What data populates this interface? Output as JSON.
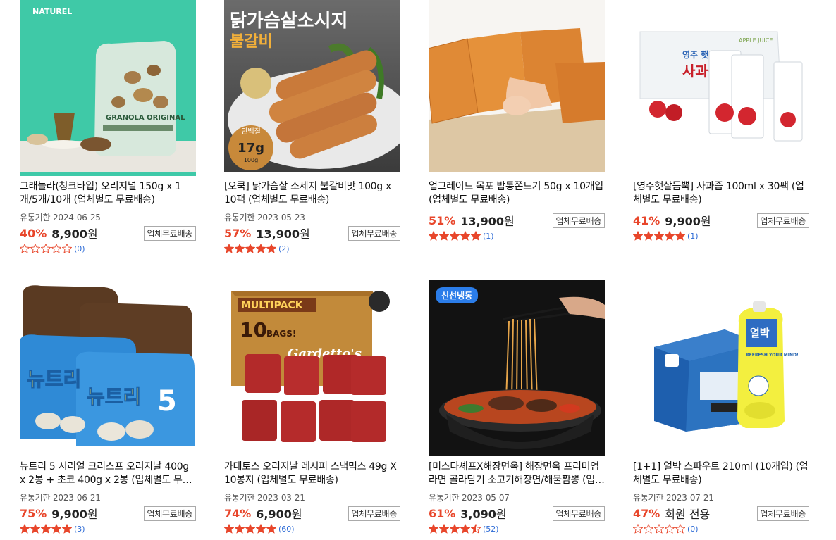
{
  "products": [
    {
      "title": "그래놀라(청크타입) 오리지널 150g x 1개/5개/10개 (업체별도 무료배송)",
      "expiry": "유통기한 2024-06-25",
      "discount": "40%",
      "price": "8,900",
      "price_unit": "원",
      "member_only": "",
      "shipping": "업체무료배송",
      "rating": 0,
      "reviews": "(0)",
      "image_brand": "NATUREL",
      "image_text": "GRANOLA ORIGINAL",
      "badge": ""
    },
    {
      "title": "[오쿡] 닭가슴살 소세지 불갈비맛 100g x 10팩 (업체별도 무료배송)",
      "expiry": "유통기한 2023-05-23",
      "discount": "57%",
      "price": "13,900",
      "price_unit": "원",
      "member_only": "",
      "shipping": "업체무료배송",
      "rating": 5,
      "reviews": "(2)",
      "image_headline": "닭가슴살소시지",
      "image_sub": "불갈비",
      "image_protein_label": "단백질",
      "image_protein_value": "17g",
      "image_protein_unit": "100g",
      "badge": ""
    },
    {
      "title": "업그레이드 목포 밥통쫀드기 50g x 10개입 (업체별도 무료배송)",
      "expiry": "",
      "discount": "51%",
      "price": "13,900",
      "price_unit": "원",
      "member_only": "",
      "shipping": "업체무료배송",
      "rating": 5,
      "reviews": "(1)",
      "badge": ""
    },
    {
      "title": "[영주햇살듬뿍] 사과즙 100ml x 30팩 (업체별도 무료배송)",
      "expiry": "",
      "discount": "41%",
      "price": "9,900",
      "price_unit": "원",
      "member_only": "",
      "shipping": "업체무료배송",
      "rating": 5,
      "reviews": "(1)",
      "image_box_text": "APPLE JUICE",
      "image_brand": "영주 햇살듬뿍",
      "image_product": "사과즙",
      "badge": ""
    },
    {
      "title": "뉴트리 5 시리얼 크리스프 오리지날 400g x 2봉 + 초코 400g x 2봉 (업체별도 무료배송)",
      "expiry": "유통기한 2023-06-21",
      "discount": "75%",
      "price": "9,900",
      "price_unit": "원",
      "member_only": "",
      "shipping": "업체무료배송",
      "rating": 5,
      "reviews": "(3)",
      "image_brand": "뉴트리",
      "image_number": "5",
      "badge": ""
    },
    {
      "title": "가데토스 오리지날 레시피 스낵믹스 49g X 10봉지 (업체별도 무료배송)",
      "expiry": "유통기한 2023-03-21",
      "discount": "74%",
      "price": "6,900",
      "price_unit": "원",
      "member_only": "",
      "shipping": "업체무료배송",
      "rating": 5,
      "reviews": "(60)",
      "image_box": "MULTIPACK",
      "image_count": "10",
      "image_bags": "BAGS!",
      "image_brand": "Gardetto's",
      "badge": ""
    },
    {
      "title": "[미스타셰프X해장면옥] 해장면옥 프리미엄 라면 골라담기 소고기해장면/해물짬뽕 (업체별도 무료배송)",
      "expiry": "유통기한 2023-05-07",
      "discount": "61%",
      "price": "3,090",
      "price_unit": "원",
      "member_only": "",
      "shipping": "업체무료배송",
      "rating": 4.5,
      "reviews": "(52)",
      "badge": "신선냉동"
    },
    {
      "title": "[1+1] 얼박 스파우트 210ml (10개입) (업체별도 무료배송)",
      "expiry": "유통기한 2023-07-21",
      "discount": "47%",
      "price": "",
      "price_unit": "",
      "member_only": "회원 전용",
      "shipping": "업체무료배송",
      "rating": 0,
      "reviews": "(0)",
      "image_brand": "얼박",
      "image_slogan": "REFRESH YOUR MIND!",
      "badge": ""
    }
  ],
  "colors": {
    "discount": "#e8462b",
    "star_filled": "#e8462b",
    "review_link": "#2d6bd6"
  }
}
